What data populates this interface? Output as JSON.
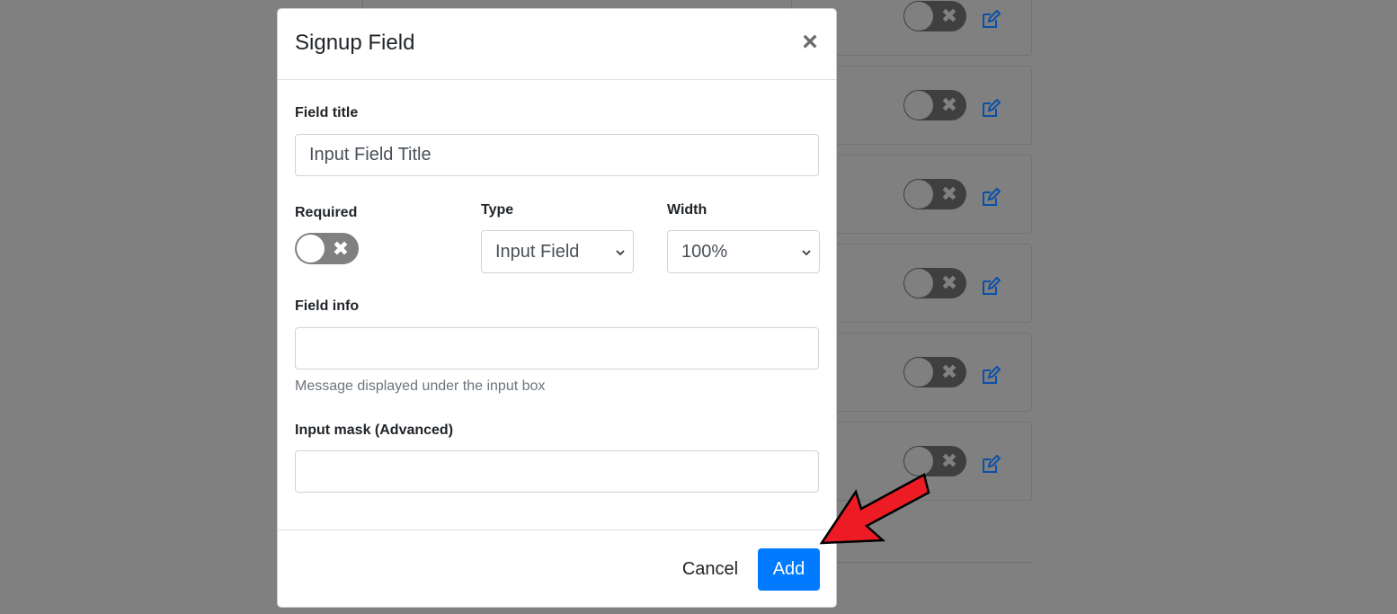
{
  "colors": {
    "overlay": "#808080",
    "primary": "#007bff",
    "toggle_off": "#808080",
    "arrow": "#ed1c24",
    "edit_icon": "#0b4fa8"
  },
  "background": {
    "rows": [
      {
        "toggle_icon": "close-icon",
        "edit_icon": "edit-icon"
      },
      {
        "toggle_icon": "close-icon",
        "edit_icon": "edit-icon"
      },
      {
        "toggle_icon": "close-icon",
        "edit_icon": "edit-icon"
      },
      {
        "toggle_icon": "close-icon",
        "edit_icon": "edit-icon"
      },
      {
        "toggle_icon": "close-icon",
        "edit_icon": "edit-icon"
      },
      {
        "toggle_icon": "close-icon",
        "edit_icon": "edit-icon"
      }
    ]
  },
  "modal": {
    "title": "Signup Field",
    "close_symbol": "×",
    "field_title": {
      "label": "Field title",
      "placeholder": "Input Field Title",
      "value": ""
    },
    "required": {
      "label": "Required",
      "checked": false,
      "off_symbol": "✖"
    },
    "type": {
      "label": "Type",
      "selected": "Input Field"
    },
    "width": {
      "label": "Width",
      "selected": "100%"
    },
    "field_info": {
      "label": "Field info",
      "value": "",
      "help": "Message displayed under the input box"
    },
    "input_mask": {
      "label": "Input mask (Advanced)",
      "value": ""
    },
    "footer": {
      "cancel_label": "Cancel",
      "add_label": "Add"
    }
  },
  "annotation": {
    "arrow_icon": "red-arrow-icon",
    "points_to": "add-button"
  }
}
